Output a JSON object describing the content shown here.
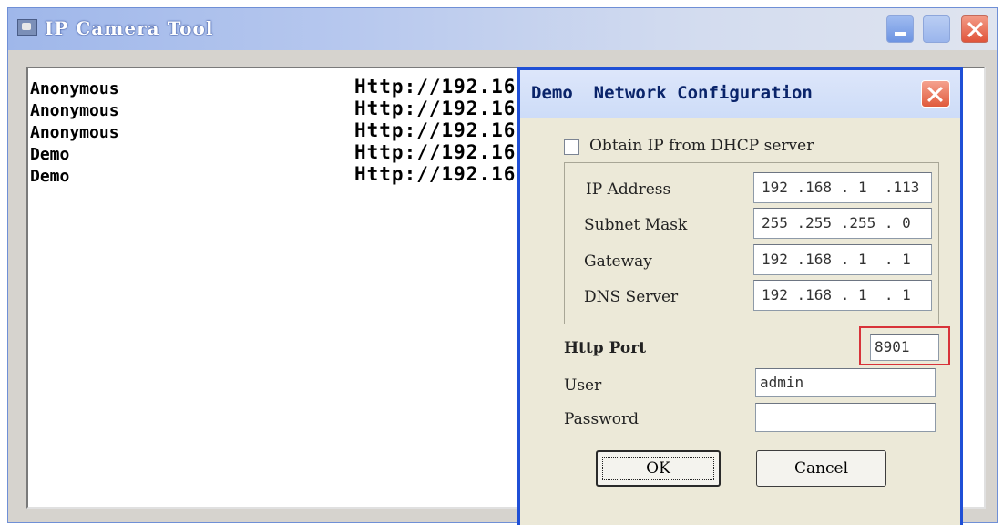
{
  "main_window": {
    "title": "IP Camera Tool",
    "devices": [
      {
        "name": "Anonymous",
        "url": "Http://192.16"
      },
      {
        "name": "Anonymous",
        "url": "Http://192.16"
      },
      {
        "name": "Anonymous",
        "url": "Http://192.16"
      },
      {
        "name": "Demo",
        "url": "Http://192.16"
      },
      {
        "name": "Demo",
        "url": "Http://192.16"
      }
    ]
  },
  "dialog": {
    "title": "Demo  Network Configuration",
    "dhcp_label": "Obtain IP from DHCP server",
    "dhcp_checked": false,
    "fields": {
      "ip_address": {
        "label": "IP Address",
        "value": "192 .168 . 1  .113"
      },
      "subnet_mask": {
        "label": "Subnet Mask",
        "value": "255 .255 .255 . 0"
      },
      "gateway": {
        "label": "Gateway",
        "value": "192 .168 . 1  . 1"
      },
      "dns_server": {
        "label": "DNS Server",
        "value": "192 .168 . 1  . 1"
      },
      "http_port": {
        "label": "Http Port",
        "value": "8901"
      },
      "user": {
        "label": "User",
        "value": "admin"
      },
      "password": {
        "label": "Password",
        "value": ""
      }
    },
    "ok_label": "OK",
    "cancel_label": "Cancel",
    "highlight_color": "#d8333a"
  }
}
